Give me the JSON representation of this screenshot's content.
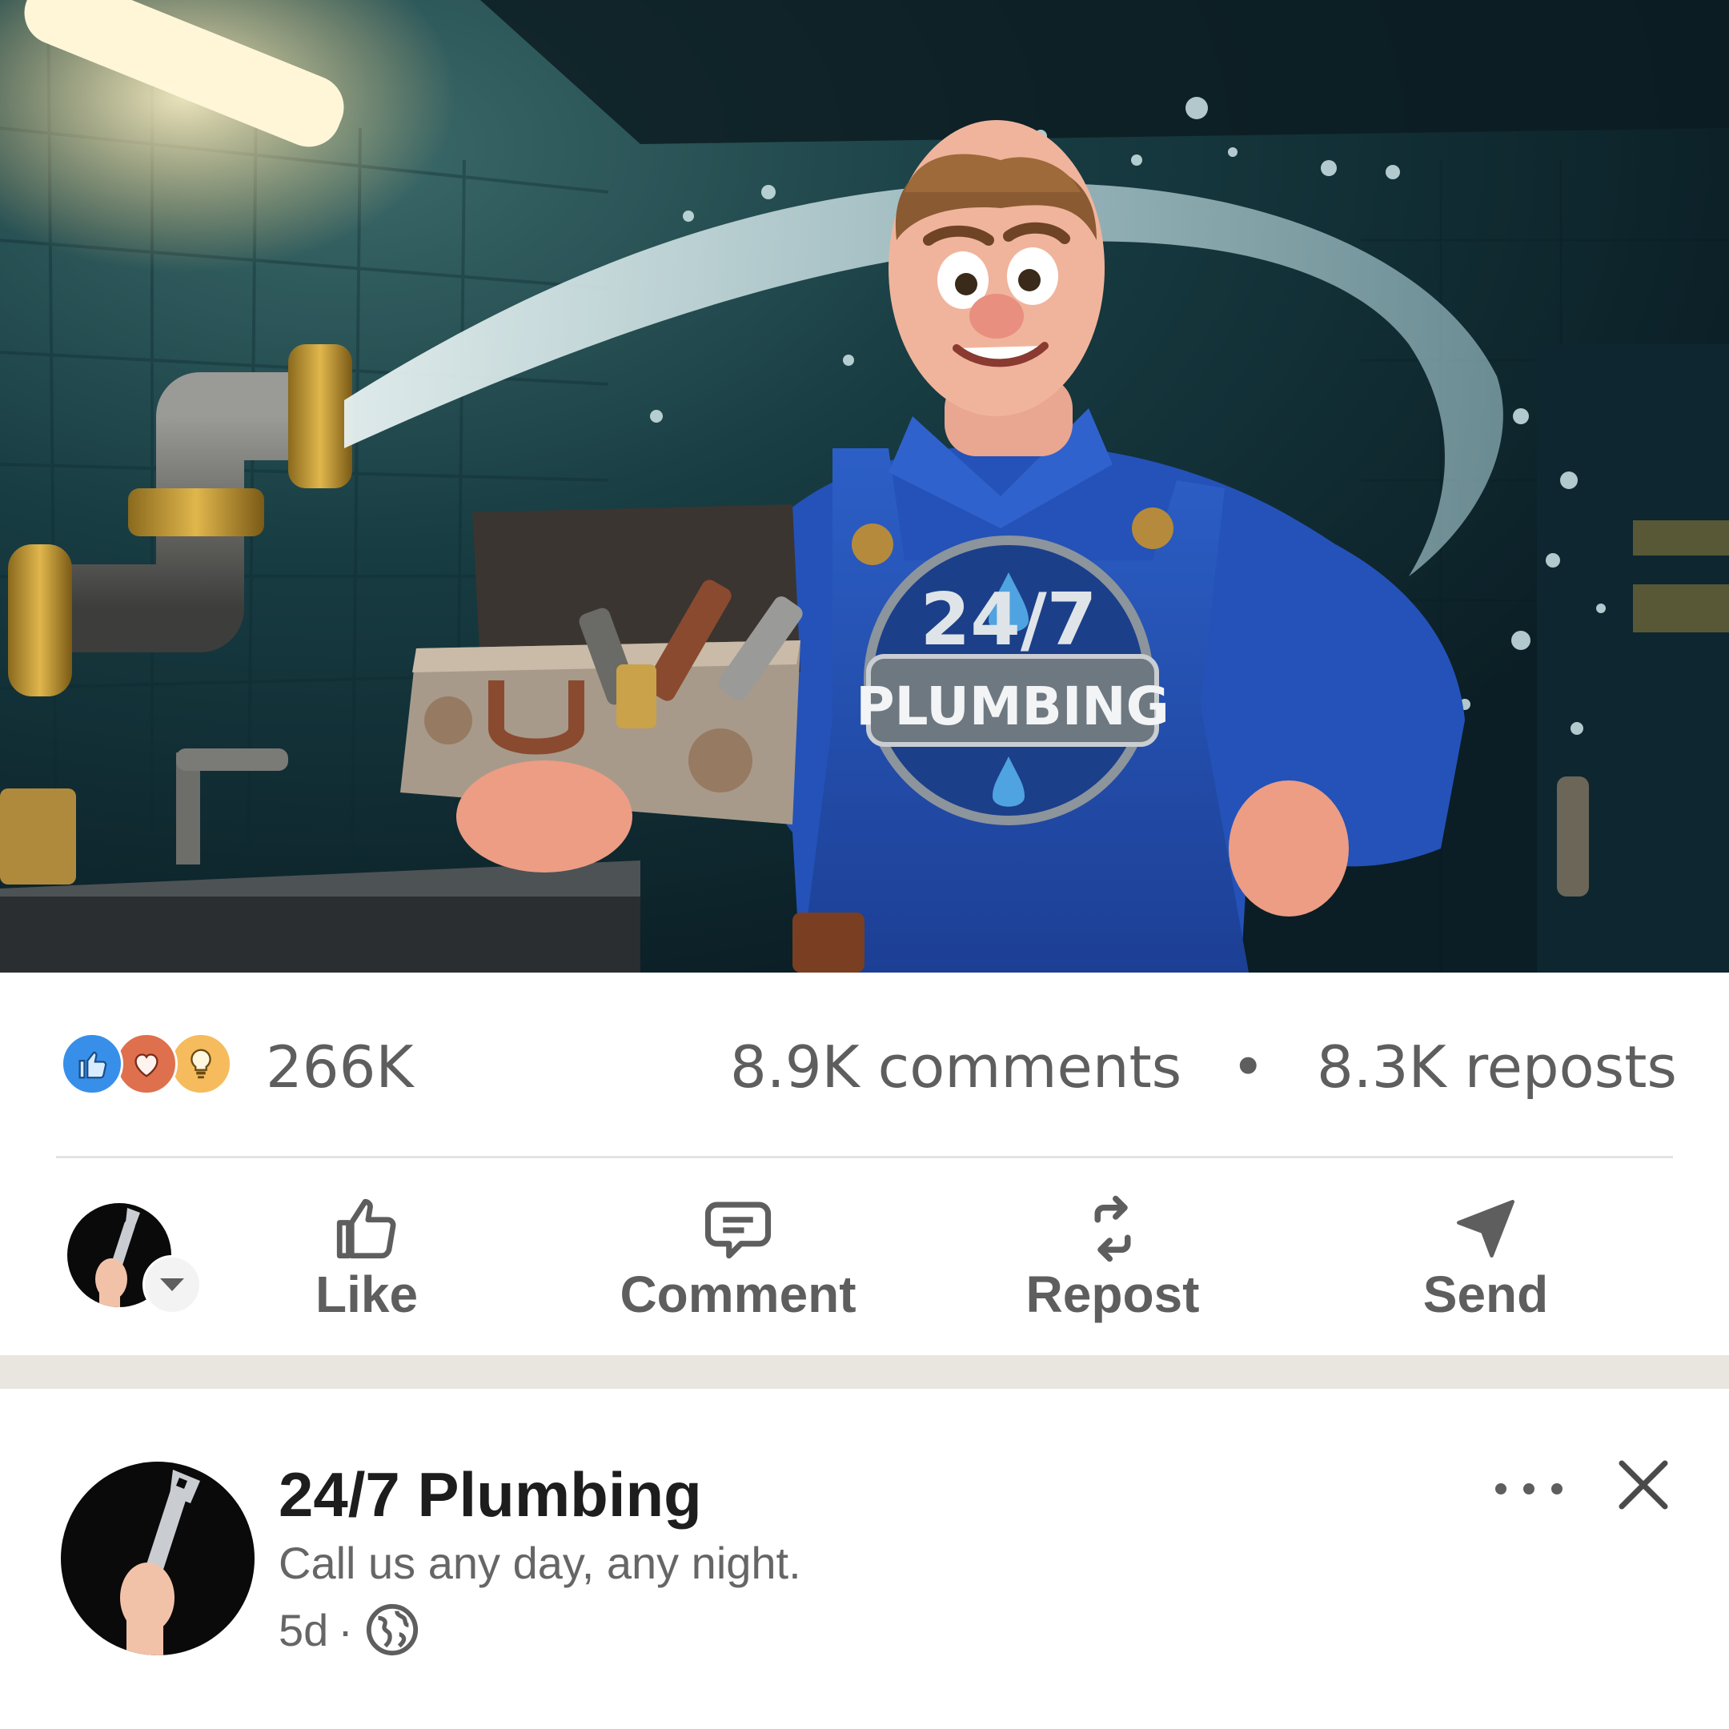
{
  "post_image": {
    "overall_badge_line1": "24/7",
    "overall_badge_line2": "PLUMBING"
  },
  "social_counts": {
    "reaction_count": "266K",
    "comments": "8.9K comments",
    "separator": "•",
    "reposts": "8.3K reposts",
    "reaction_icons": [
      "like-icon",
      "love-icon",
      "insightful-icon"
    ]
  },
  "actions": {
    "like": "Like",
    "comment": "Comment",
    "repost": "Repost",
    "send": "Send"
  },
  "next_post": {
    "author_name": "24/7 Plumbing",
    "tagline": "Call us any day, any night.",
    "age": "5d",
    "meta_separator": "·",
    "visibility_icon": "globe-icon"
  },
  "colors": {
    "like_blue": "#378fe9",
    "love_red": "#df704d",
    "insight_yellow": "#f5bb5c",
    "text_gray": "#5e5e5e",
    "feed_gap": "#e9e6df"
  }
}
